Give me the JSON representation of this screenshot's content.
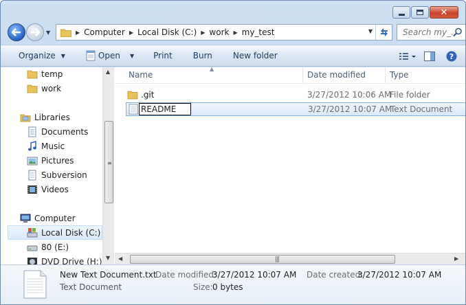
{
  "window": {
    "caption": {
      "minimize": "minimize",
      "maximize": "maximize",
      "close": "close"
    }
  },
  "address": {
    "crumbs": [
      "Computer",
      "Local Disk (C:)",
      "work",
      "my_test"
    ]
  },
  "search": {
    "placeholder": "Search my_..."
  },
  "toolbar": {
    "organize": "Organize",
    "open": "Open",
    "print": "Print",
    "burn": "Burn",
    "new_folder": "New folder"
  },
  "nav": {
    "items": [
      {
        "label": "temp",
        "icon": "folder-icon"
      },
      {
        "label": "work",
        "icon": "folder-icon"
      },
      {
        "label": "Libraries",
        "icon": "libraries-icon"
      },
      {
        "label": "Documents",
        "icon": "documents-icon"
      },
      {
        "label": "Music",
        "icon": "music-icon"
      },
      {
        "label": "Pictures",
        "icon": "pictures-icon"
      },
      {
        "label": "Subversion",
        "icon": "subversion-icon"
      },
      {
        "label": "Videos",
        "icon": "videos-icon"
      },
      {
        "label": "Computer",
        "icon": "computer-icon"
      },
      {
        "label": "Local Disk (C:)",
        "icon": "local-disk-icon",
        "selected": true
      },
      {
        "label": "80 (E:)",
        "icon": "drive-icon"
      },
      {
        "label": "DVD Drive (H:) X(",
        "icon": "dvd-drive-icon"
      }
    ]
  },
  "columns": {
    "name": "Name",
    "date": "Date modified",
    "type": "Type"
  },
  "files": [
    {
      "name": ".git",
      "date": "3/27/2012 10:06 AM",
      "type": "File folder",
      "icon": "folder-icon"
    },
    {
      "name": "README",
      "date": "3/27/2012 10:07 AM",
      "type": "Text Document",
      "icon": "text-file-icon",
      "renaming": true
    }
  ],
  "details": {
    "filename": "New Text Document.txt",
    "filetype": "Text Document",
    "date_modified_label": "Date modified:",
    "date_modified": "3/27/2012 10:07 AM",
    "size_label": "Size:",
    "size": "0 bytes",
    "date_created_label": "Date created:",
    "date_created": "3/27/2012 10:07 AM"
  }
}
